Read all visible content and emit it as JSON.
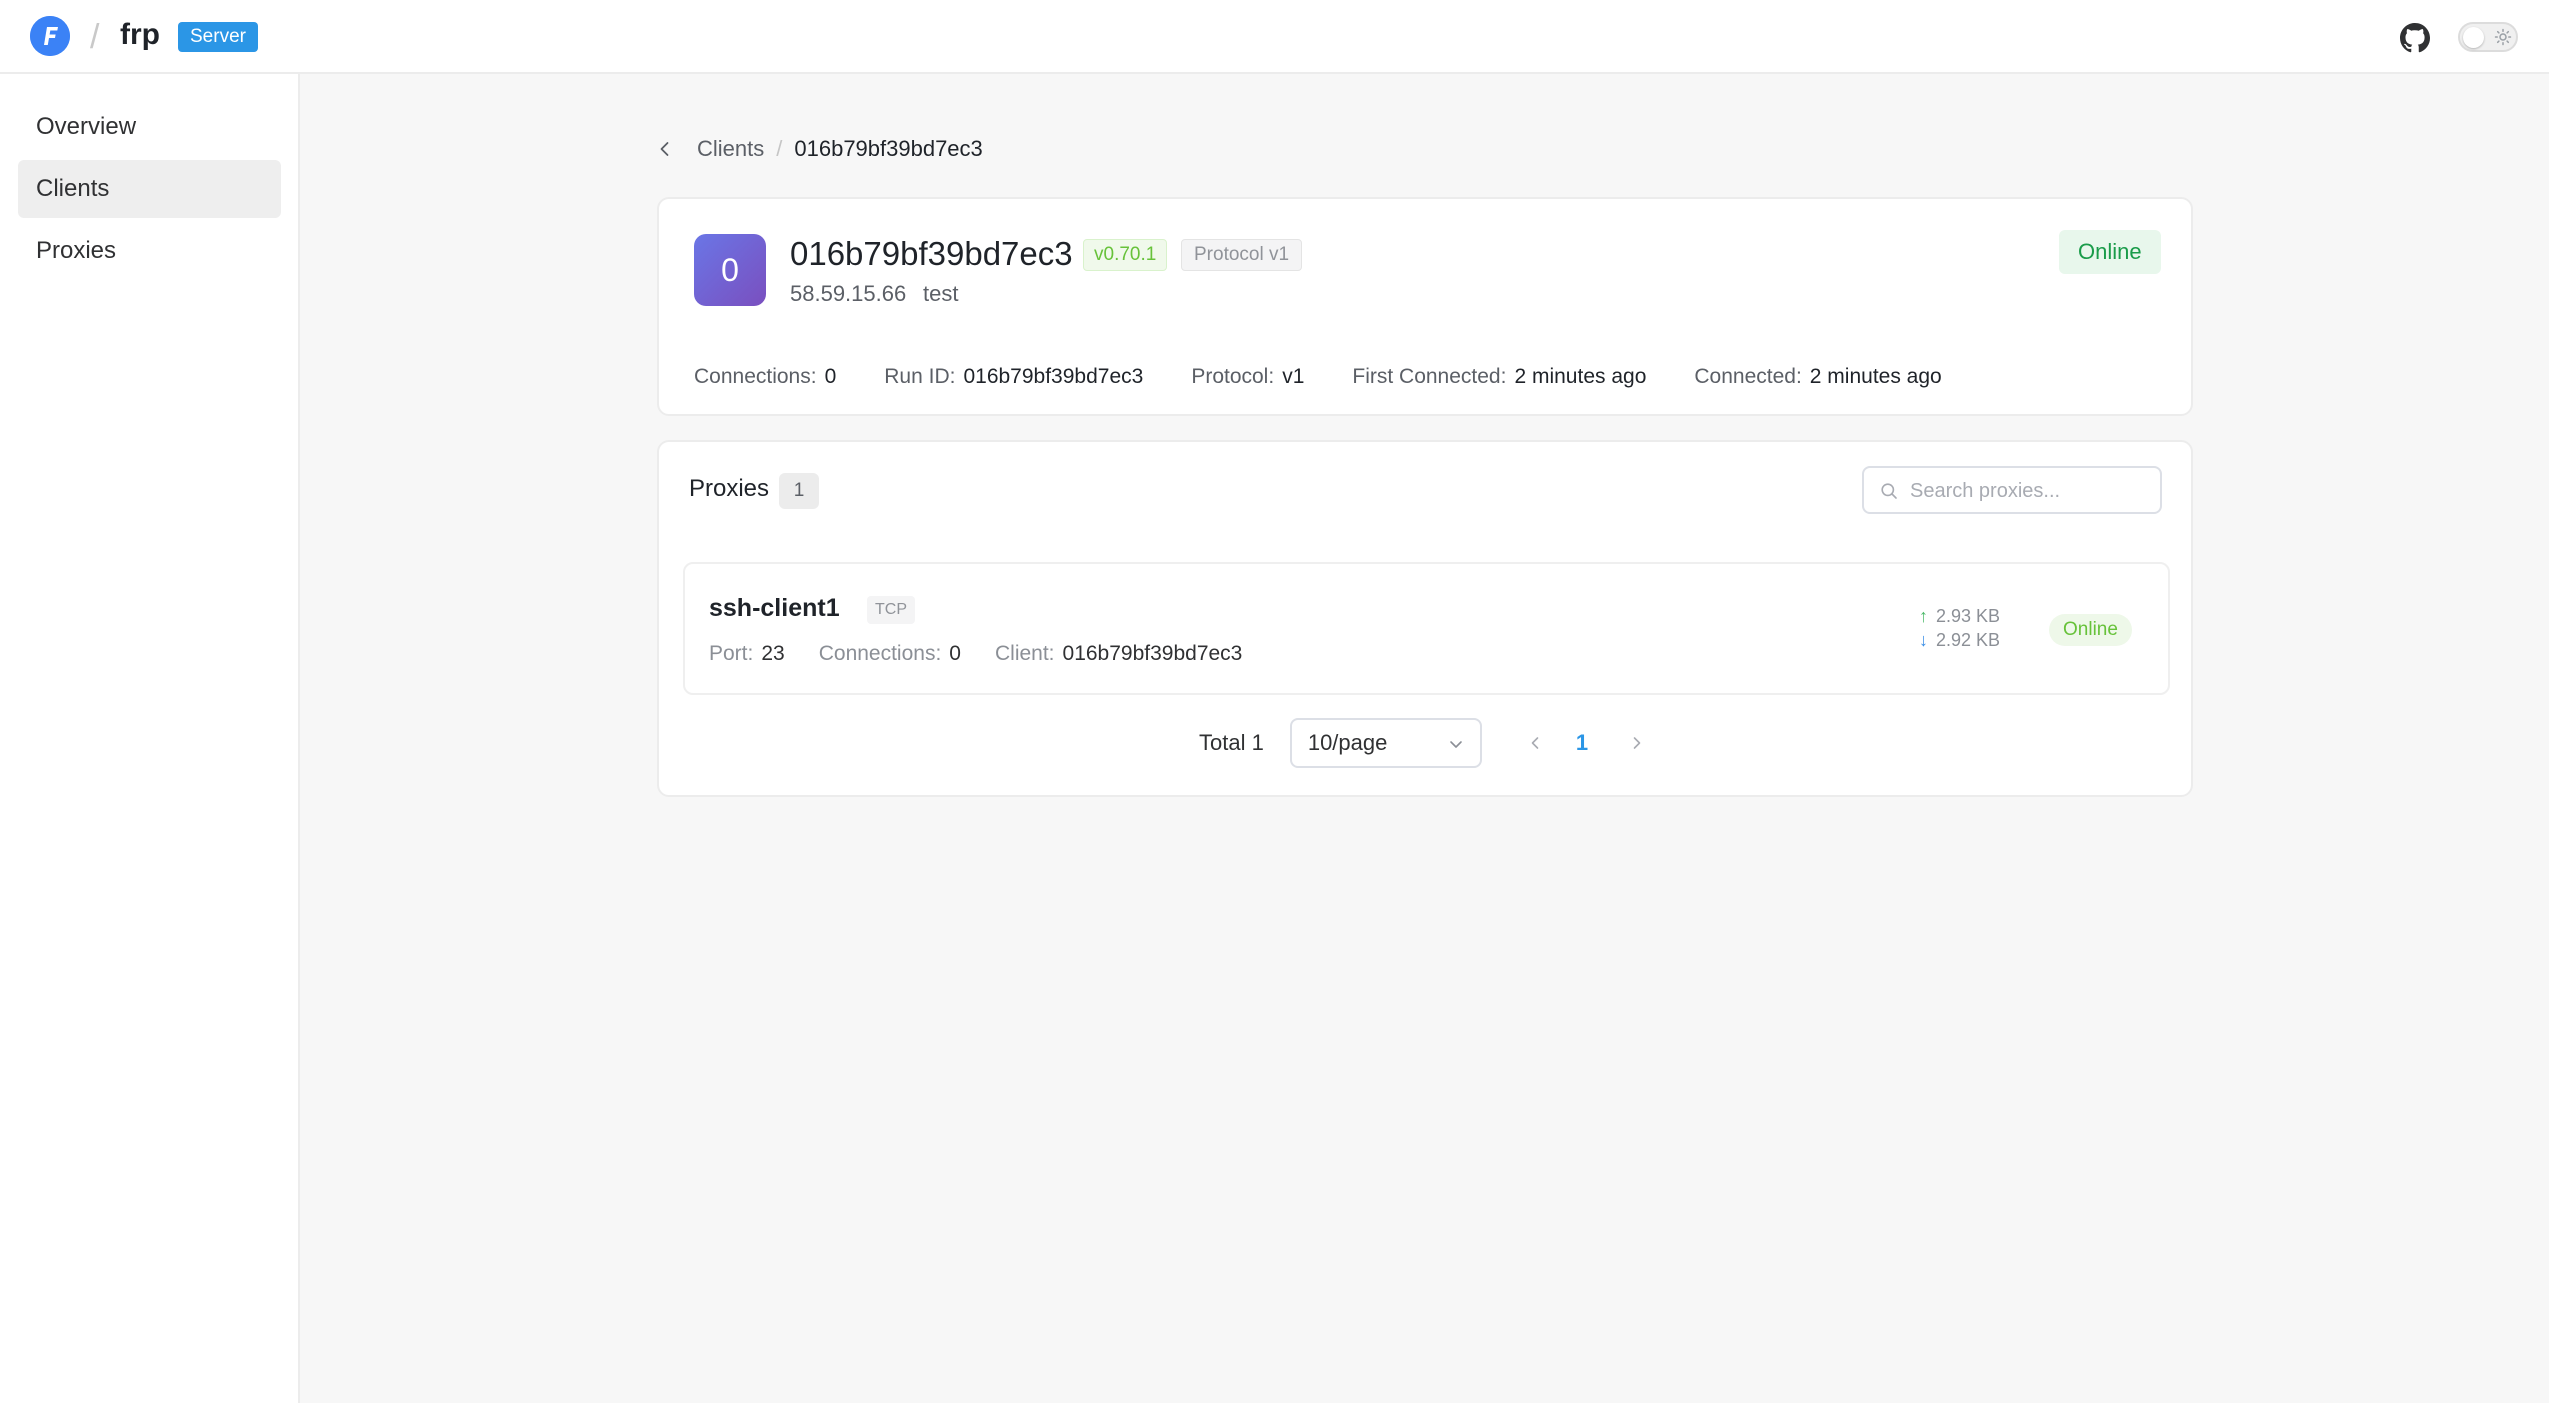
{
  "header": {
    "logo_letter": "F",
    "brand": "frp",
    "badge": "Server",
    "accent_color": "#2b96e6",
    "github_icon": "github-icon",
    "theme_icon": "sun-icon"
  },
  "sidebar": {
    "items": [
      {
        "label": "Overview",
        "active": false
      },
      {
        "label": "Clients",
        "active": true
      },
      {
        "label": "Proxies",
        "active": false
      }
    ]
  },
  "breadcrumb": {
    "parent": "Clients",
    "current": "016b79bf39bd7ec3"
  },
  "client": {
    "avatar_letter": "0",
    "id": "016b79bf39bd7ec3",
    "version": "v0.70.1",
    "protocol_badge": "Protocol v1",
    "ip": "58.59.15.66",
    "user": "test",
    "status": "Online",
    "meta": [
      {
        "label": "Connections:",
        "value": "0"
      },
      {
        "label": "Run ID:",
        "value": "016b79bf39bd7ec3"
      },
      {
        "label": "Protocol:",
        "value": "v1"
      },
      {
        "label": "First Connected:",
        "value": "2 minutes ago"
      },
      {
        "label": "Connected:",
        "value": "2 minutes ago"
      }
    ]
  },
  "proxies": {
    "title": "Proxies",
    "count": "1",
    "search_placeholder": "Search proxies...",
    "items": [
      {
        "name": "ssh-client1",
        "type": "TCP",
        "port_label": "Port:",
        "port": "23",
        "connections_label": "Connections:",
        "connections": "0",
        "client_label": "Client:",
        "client": "016b79bf39bd7ec3",
        "traffic_in": "2.93 KB",
        "traffic_out": "2.92 KB",
        "status": "Online"
      }
    ],
    "pagination": {
      "total": "Total 1",
      "page_size": "10/page",
      "current_page": "1"
    }
  }
}
